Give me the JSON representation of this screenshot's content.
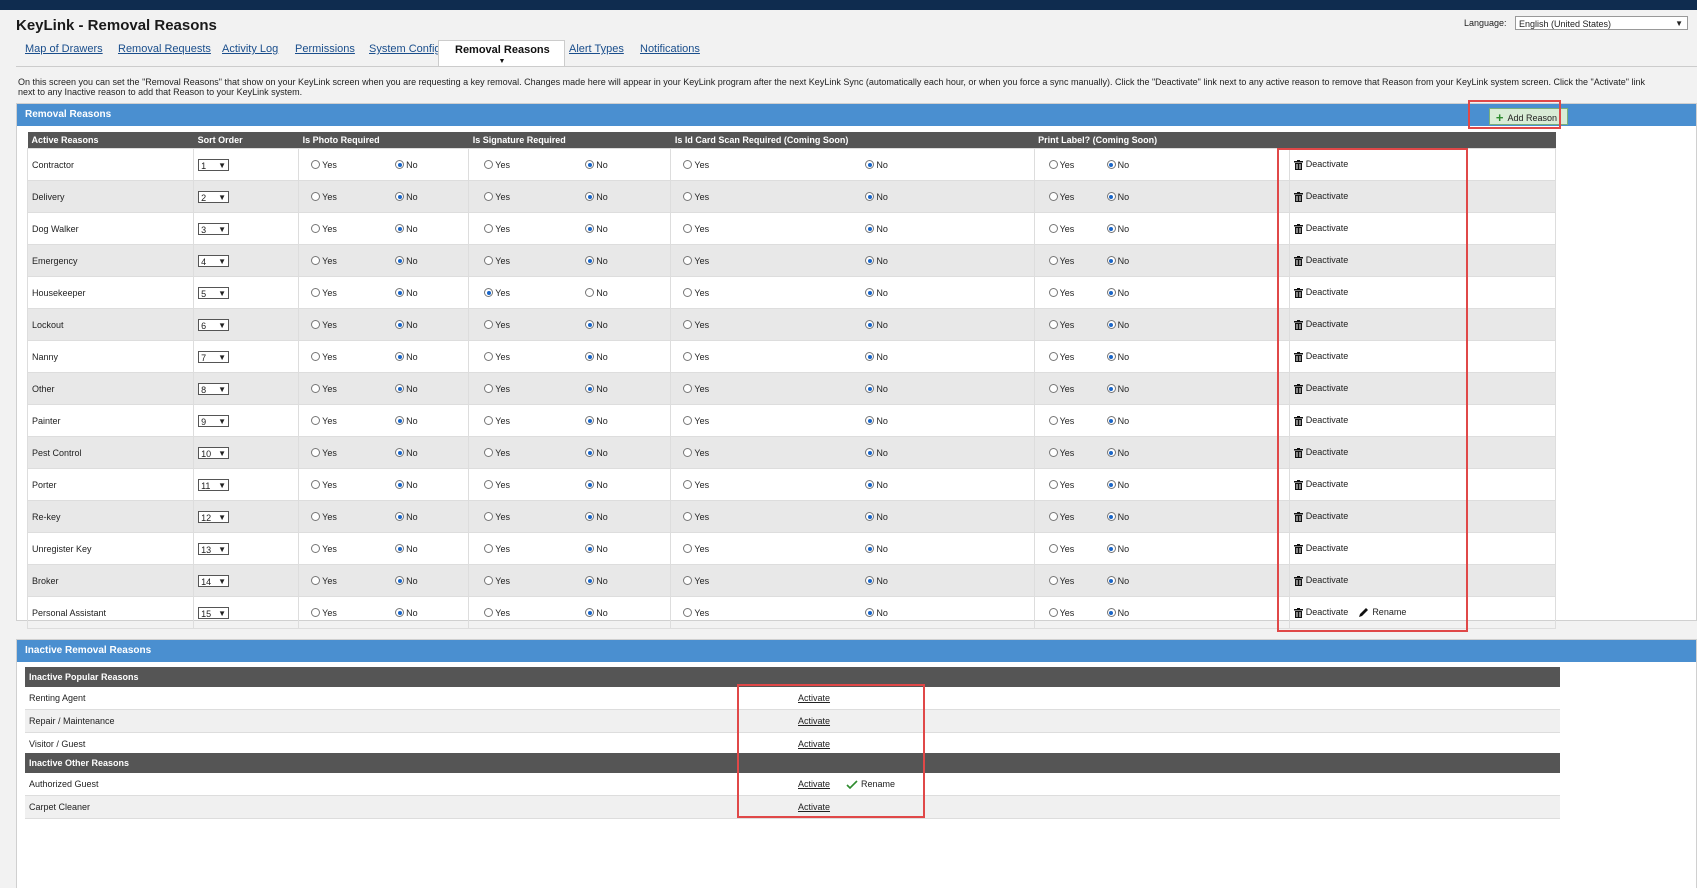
{
  "app_title": "KeyLink - Removal Reasons",
  "language": {
    "label": "Language:",
    "value": "English (United States)"
  },
  "tabs": [
    {
      "label": "Map of Drawers"
    },
    {
      "label": "Removal Requests"
    },
    {
      "label": "Activity Log"
    },
    {
      "label": "Permissions"
    },
    {
      "label": "System Config"
    },
    {
      "label": "Removal Reasons"
    },
    {
      "label": "Alert Types"
    },
    {
      "label": "Notifications"
    }
  ],
  "active_tab": "Removal Reasons",
  "intro": "On this screen you can set the \"Removal Reasons\" that show on your KeyLink screen when you are requesting a key removal. Changes made here will appear in your KeyLink program after the next KeyLink Sync (automatically each hour, or when you force a sync manually). Click the \"Deactivate\" link next to any active reason to remove that Reason from your KeyLink system screen. Click the \"Activate\" link next to any Inactive reason to add that Reason to your KeyLink system.",
  "active_panel": {
    "title": "Removal Reasons",
    "add_button": "Add Reason",
    "columns": [
      "Active Reasons",
      "Sort Order",
      "Is Photo Required",
      "Is Signature Required",
      "Is Id Card Scan Required (Coming Soon)",
      "Print Label? (Coming Soon)",
      ""
    ],
    "yes_label": "Yes",
    "no_label": "No",
    "deactivate_label": "Deactivate",
    "rename_label": "Rename",
    "rows": [
      {
        "name": "Contractor",
        "order": "1",
        "photo": "No",
        "signature": "No",
        "idscan": "No",
        "label": "No"
      },
      {
        "name": "Delivery",
        "order": "2",
        "photo": "No",
        "signature": "No",
        "idscan": "No",
        "label": "No"
      },
      {
        "name": "Dog Walker",
        "order": "3",
        "photo": "No",
        "signature": "No",
        "idscan": "No",
        "label": "No"
      },
      {
        "name": "Emergency",
        "order": "4",
        "photo": "No",
        "signature": "No",
        "idscan": "No",
        "label": "No"
      },
      {
        "name": "Housekeeper",
        "order": "5",
        "photo": "No",
        "signature": "Yes",
        "idscan": "No",
        "label": "No"
      },
      {
        "name": "Lockout",
        "order": "6",
        "photo": "No",
        "signature": "No",
        "idscan": "No",
        "label": "No"
      },
      {
        "name": "Nanny",
        "order": "7",
        "photo": "No",
        "signature": "No",
        "idscan": "No",
        "label": "No"
      },
      {
        "name": "Other",
        "order": "8",
        "photo": "No",
        "signature": "No",
        "idscan": "No",
        "label": "No"
      },
      {
        "name": "Painter",
        "order": "9",
        "photo": "No",
        "signature": "No",
        "idscan": "No",
        "label": "No"
      },
      {
        "name": "Pest Control",
        "order": "10",
        "photo": "No",
        "signature": "No",
        "idscan": "No",
        "label": "No"
      },
      {
        "name": "Porter",
        "order": "11",
        "photo": "No",
        "signature": "No",
        "idscan": "No",
        "label": "No"
      },
      {
        "name": "Re-key",
        "order": "12",
        "photo": "No",
        "signature": "No",
        "idscan": "No",
        "label": "No"
      },
      {
        "name": "Unregister Key",
        "order": "13",
        "photo": "No",
        "signature": "No",
        "idscan": "No",
        "label": "No"
      },
      {
        "name": "Broker",
        "order": "14",
        "photo": "No",
        "signature": "No",
        "idscan": "No",
        "label": "No"
      },
      {
        "name": "Personal Assistant",
        "order": "15",
        "photo": "No",
        "signature": "No",
        "idscan": "No",
        "label": "No",
        "rename": true
      }
    ]
  },
  "inactive_panel": {
    "title": "Inactive Removal Reasons",
    "activate_label": "Activate",
    "rename_label": "Rename",
    "popular_header": "Inactive Popular Reasons",
    "popular": [
      {
        "name": "Renting Agent"
      },
      {
        "name": "Repair / Maintenance"
      },
      {
        "name": "Visitor / Guest"
      }
    ],
    "other_header": "Inactive Other Reasons",
    "other": [
      {
        "name": "Authorized Guest",
        "rename": true
      },
      {
        "name": "Carpet Cleaner"
      }
    ]
  },
  "colors": {
    "panel_header": "#4a8fd0",
    "table_header": "#555555",
    "highlight": "#e04848",
    "top_bar": "#0f2c4f"
  }
}
